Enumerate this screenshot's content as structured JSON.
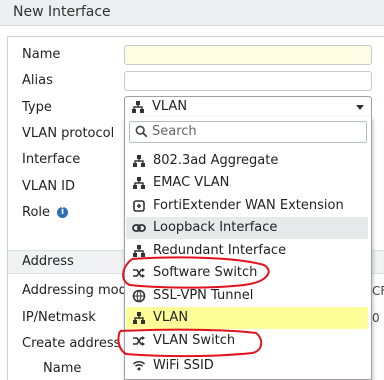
{
  "window": {
    "title": "New Interface"
  },
  "form": {
    "name_label": "Name",
    "alias_label": "Alias",
    "type_label": "Type",
    "vlan_protocol_label": "VLAN protocol",
    "interface_label": "Interface",
    "vlan_id_label": "VLAN ID",
    "role_label": "Role",
    "address_section": "Address",
    "addressing_mode_label": "Addressing mode",
    "addressing_mode_fragment": "CF",
    "ip_netmask_label": "IP/Netmask",
    "ip_netmask_fragment": "0",
    "create_address_label": "Create address ol",
    "sub_name_label": "Name"
  },
  "type_select": {
    "value": "VLAN",
    "icon": "vlan-icon",
    "search_placeholder": "Search",
    "options": [
      {
        "label": "802.3ad Aggregate",
        "icon": "network-icon"
      },
      {
        "label": "EMAC VLAN",
        "icon": "network-icon"
      },
      {
        "label": "FortiExtender WAN Extension",
        "icon": "extender-icon"
      },
      {
        "label": "Loopback Interface",
        "icon": "loopback-icon",
        "state": "hover"
      },
      {
        "label": "Redundant Interface",
        "icon": "network-icon"
      },
      {
        "label": "Software Switch",
        "icon": "switch-icon",
        "annotated": true
      },
      {
        "label": "SSL-VPN Tunnel",
        "icon": "vpn-icon"
      },
      {
        "label": "VLAN",
        "icon": "network-icon",
        "state": "selected"
      },
      {
        "label": "VLAN Switch",
        "icon": "switch-icon",
        "annotated": true
      },
      {
        "label": "WiFi SSID",
        "icon": "wifi-icon"
      }
    ]
  },
  "colors": {
    "selected_bg": "#ffff99",
    "hover_bg": "#e8e9ea",
    "required_input_bg": "#fffde3",
    "annotation_red": "#e0141e",
    "info_blue": "#2e6fb4"
  }
}
